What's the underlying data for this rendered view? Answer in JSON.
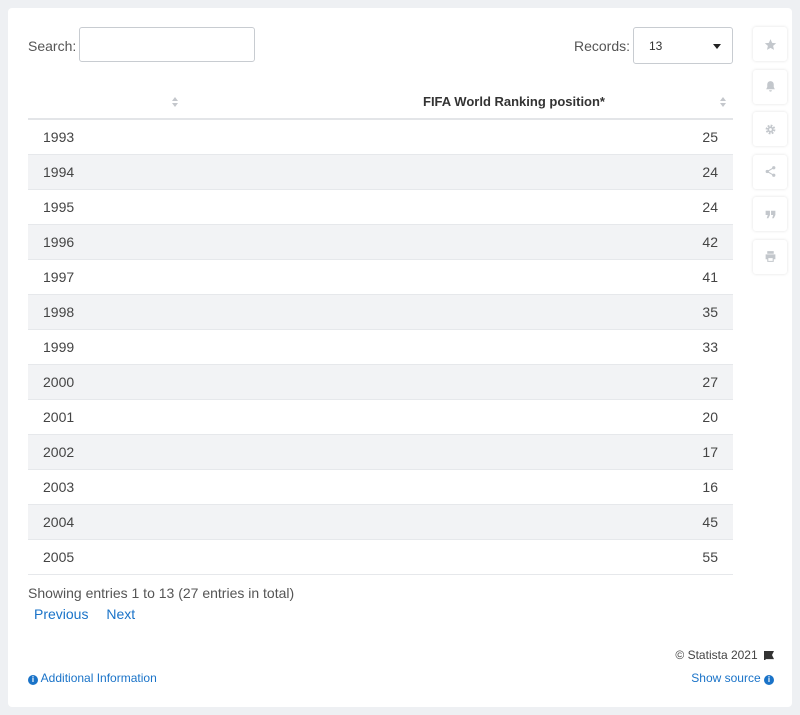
{
  "controls": {
    "search_label": "Search:",
    "search_value": "",
    "records_label": "Records:",
    "records_value": "13"
  },
  "table": {
    "columns": [
      "",
      "FIFA World Ranking position*"
    ],
    "rows": [
      {
        "year": "1993",
        "rank": "25"
      },
      {
        "year": "1994",
        "rank": "24"
      },
      {
        "year": "1995",
        "rank": "24"
      },
      {
        "year": "1996",
        "rank": "42"
      },
      {
        "year": "1997",
        "rank": "41"
      },
      {
        "year": "1998",
        "rank": "35"
      },
      {
        "year": "1999",
        "rank": "33"
      },
      {
        "year": "2000",
        "rank": "27"
      },
      {
        "year": "2001",
        "rank": "20"
      },
      {
        "year": "2002",
        "rank": "17"
      },
      {
        "year": "2003",
        "rank": "16"
      },
      {
        "year": "2004",
        "rank": "45"
      },
      {
        "year": "2005",
        "rank": "55"
      }
    ]
  },
  "footer": {
    "showing": "Showing entries 1 to 13 (27 entries in total)",
    "previous": "Previous",
    "next": "Next",
    "copyright": "© Statista 2021",
    "additional_info": "Additional Information",
    "show_source": "Show source"
  },
  "sidebar_icons": [
    "star-icon",
    "bell-icon",
    "gear-icon",
    "share-icon",
    "quote-icon",
    "print-icon"
  ],
  "colors": {
    "link": "#1a73c8",
    "stripe": "#f2f3f5",
    "icon": "#c3c7cc"
  }
}
